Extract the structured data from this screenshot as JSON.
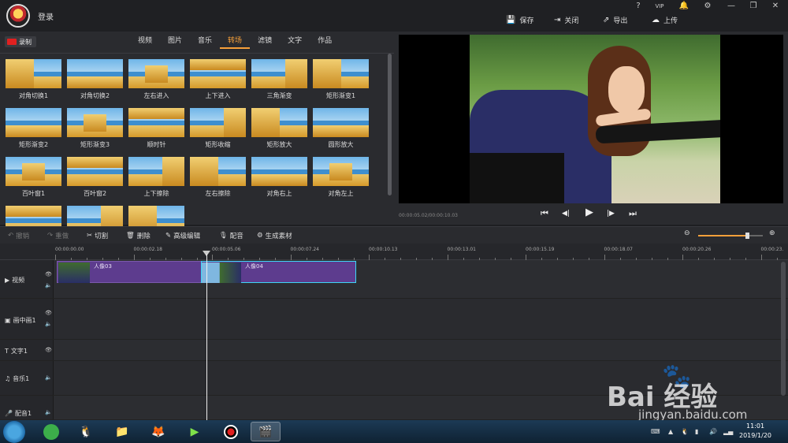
{
  "header": {
    "login": "登录",
    "window_controls": [
      "?",
      "VIP",
      "🔔",
      "⚙",
      "—",
      "❐",
      "✕"
    ],
    "actions": [
      {
        "label": "保存",
        "icon": "save-icon"
      },
      {
        "label": "关闭",
        "icon": "exit-icon"
      },
      {
        "label": "导出",
        "icon": "export-icon"
      },
      {
        "label": "上传",
        "icon": "upload-icon"
      }
    ]
  },
  "library": {
    "record_label": "录制",
    "tabs": [
      "视频",
      "图片",
      "音乐",
      "转场",
      "滤镜",
      "文字",
      "作品"
    ],
    "active_tab": "转场",
    "transitions": [
      "对角切换1",
      "对角切换2",
      "左右进入",
      "上下进入",
      "三角渐变",
      "矩形渐变1",
      "矩形渐变2",
      "矩形渐变3",
      "顺时针",
      "矩形收缩",
      "矩形放大",
      "圆形放大",
      "百叶窗1",
      "百叶窗2",
      "上下擦除",
      "左右擦除",
      "对角右上",
      "对角左上",
      "",
      "",
      ""
    ]
  },
  "preview": {
    "timecode": "00:00:05.02/00:00:10.03",
    "controls": [
      "⏮",
      "◀|",
      "▶",
      "|▶",
      "⏭"
    ]
  },
  "toolbar": {
    "undo": "撤销",
    "redo": "重做",
    "cut": "切割",
    "delete": "删除",
    "advanced_edit": "高级编辑",
    "dub": "配音",
    "generate": "生成素材",
    "zoom_level": 0.75
  },
  "ruler": [
    "00:00:00.00",
    "00:00:02.18",
    "00:00:05.06",
    "00:00:07.24",
    "00:00:10.13",
    "00:00:13.01",
    "00:00:15.19",
    "00:00:18.07",
    "00:00:20.26",
    "00:00:23."
  ],
  "tracks": [
    {
      "name": "视频",
      "icon": "▶",
      "clips": [
        {
          "label": "人像03"
        },
        {
          "label": "人像04"
        }
      ]
    },
    {
      "name": "画中画1",
      "icon": "▣"
    },
    {
      "name": "文字1",
      "icon": "T"
    },
    {
      "name": "音乐1",
      "icon": "♫"
    },
    {
      "name": "配音1",
      "icon": "🎤"
    }
  ],
  "taskbar": {
    "clock_time": "11:01",
    "clock_date": "2019/1/20"
  },
  "watermark": {
    "brand": "Bai 经验",
    "url": "jingyan.baidu.com"
  }
}
